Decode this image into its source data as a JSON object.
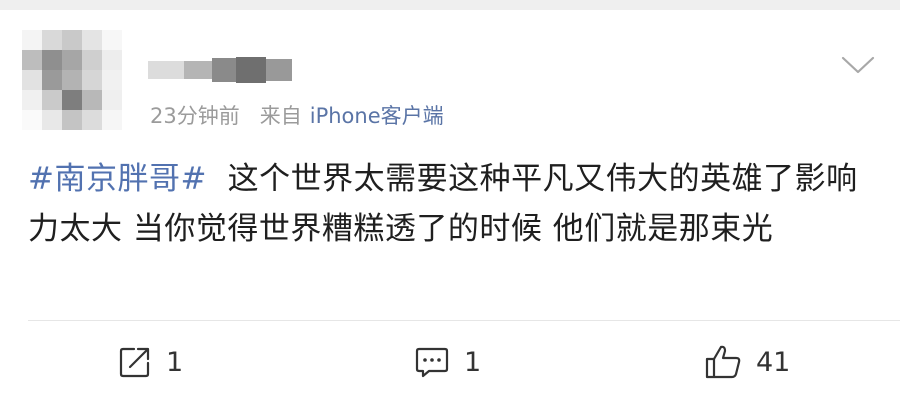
{
  "post": {
    "author_name": "",
    "time": "23分钟前",
    "source_label": "来自",
    "source": "iPhone客户端",
    "topic": "#南京胖哥#",
    "body": "这个世界太需要这种平凡又伟大的英雄了影响力太大  当你觉得世界糟糕透了的时候 他们就是那束光"
  },
  "actions": {
    "repost_count": "1",
    "comment_count": "1",
    "like_count": "41"
  },
  "colors": {
    "topic_link": "#5272b0",
    "source_link": "#5a74a6",
    "meta_gray": "#9b9b9b",
    "body_text": "#1f1f1f"
  }
}
